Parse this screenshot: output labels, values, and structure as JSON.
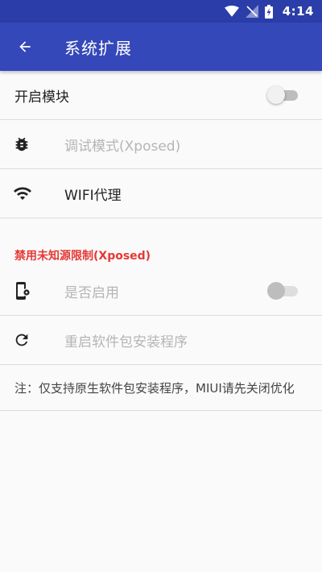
{
  "status_bar": {
    "time": "4:14",
    "icons": [
      "wifi-icon",
      "no-signal-icon",
      "battery-charging-icon"
    ]
  },
  "app_bar": {
    "back_icon": "arrow-back-icon",
    "title": "系统扩展"
  },
  "settings": {
    "enable_module": {
      "label": "开启模块",
      "on": false
    },
    "debug_mode": {
      "label": "调试模式(Xposed)",
      "icon": "bug-icon",
      "enabled": false
    },
    "wifi_proxy": {
      "label": "WIFI代理",
      "icon": "wifi-icon",
      "enabled": true
    }
  },
  "unknown_source": {
    "section_title": "禁用未知源限制(Xposed)",
    "enable": {
      "label": "是否启用",
      "icon": "phone-settings-icon",
      "on": false,
      "enabled": false
    },
    "restart_installer": {
      "label": "重启软件包安装程序",
      "icon": "refresh-icon",
      "enabled": false
    },
    "note": "注：仅支持原生软件包安装程序，MIUI请先关闭优化"
  },
  "colors": {
    "status_bar": "#2b3da8",
    "app_bar": "#3548b9",
    "section_header": "#e53935",
    "background": "#fafafa"
  }
}
